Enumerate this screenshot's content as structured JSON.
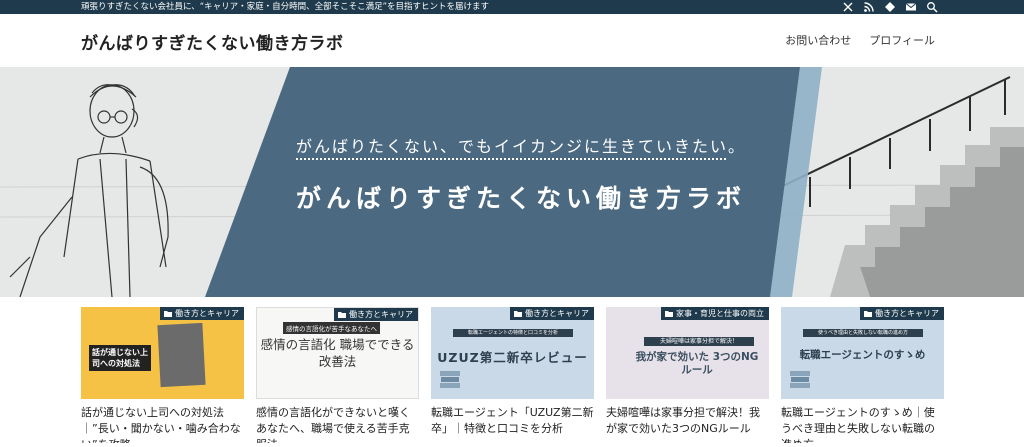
{
  "topbar": {
    "tagline": "頑張りすぎたくない会社員に、“キャリア・家庭・自分時間、全部そこそこ満足”を目指すヒントを届けます",
    "icons": [
      "x-icon",
      "rss-icon",
      "feedly-icon",
      "mail-icon",
      "search-icon"
    ]
  },
  "header": {
    "site_title": "がんばりすぎたくない働き方ラボ",
    "nav": [
      "お問い合わせ",
      "プロフィール"
    ]
  },
  "hero": {
    "catchphrase": "がんばりたくない、でもイイカンジに生きていきたい。",
    "title": "がんばりすぎたくない働き方ラボ",
    "colors": {
      "panel": "#4b6a82",
      "accent": "#8fb0c6"
    }
  },
  "cards": [
    {
      "category": "働き方とキャリア",
      "thumb_text": "話が通じない上司への対処法",
      "title": "話が通じない上司への対処法｜”長い・聞かない・噛み合わない”を攻略"
    },
    {
      "category": "働き方とキャリア",
      "thumb_sub": "感情の言語化が苦手なあなたへ",
      "thumb_main": "感情の言語化 職場でできる改善法",
      "title": "感情の言語化ができないと嘆くあなたへ、職場で使える苦手克服法"
    },
    {
      "category": "働き方とキャリア",
      "thumb_strip": "転職エージェントの特徴と口コミを分析",
      "thumb_main": "UZUZ第二新卒レビュー",
      "title": "転職エージェント「UZUZ第二新卒」｜特徴と口コミを分析"
    },
    {
      "category": "家事・育児と仕事の両立",
      "thumb_strip": "夫婦喧嘩は家事分担で解決！",
      "thumb_main": "我が家で効いた 3つのNGルール",
      "title": "夫婦喧嘩は家事分担で解決！我が家で効いた3つのNGルール"
    },
    {
      "category": "働き方とキャリア",
      "thumb_strip": "使うべき理由と失敗しない転職の進め方",
      "thumb_main": "転職エージェントのすゝめ",
      "title": "転職エージェントのすゝめ｜使うべき理由と失敗しない転職の進め方"
    }
  ],
  "colors": {
    "topbar": "#1e3a4c",
    "category_badge": "#1e3a4c"
  }
}
